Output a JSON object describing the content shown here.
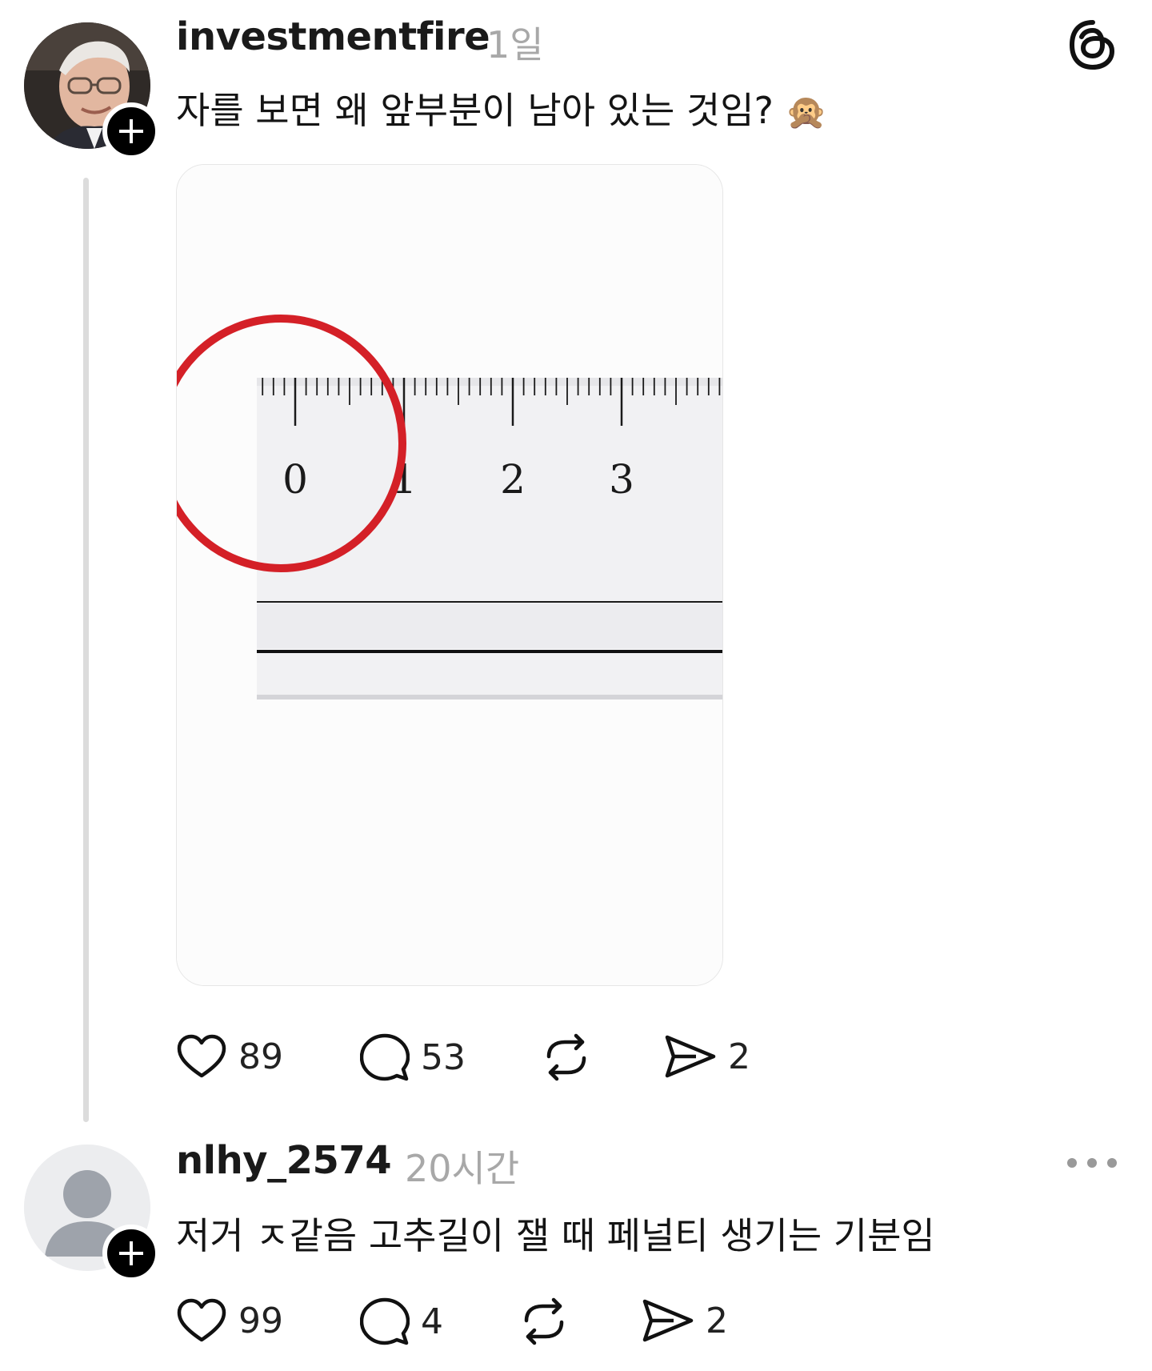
{
  "post": {
    "username": "investmentfire",
    "time": "1일",
    "text": "자를 보면 왜 앞부분이 남아 있는 것임?",
    "emoji": "🙊",
    "image": {
      "ruler_labels": [
        "0",
        "1",
        "2",
        "3"
      ]
    },
    "actions": {
      "likes": "89",
      "replies": "53",
      "reposts": "",
      "shares": "2"
    }
  },
  "reply": {
    "username": "nlhy_2574",
    "time": "20시간",
    "text": "저거 ㅈ같음 고추길이 잴 때 페널티 생기는 기분임",
    "actions": {
      "likes": "99",
      "replies": "4",
      "reposts": "",
      "shares": "2"
    }
  },
  "icons": {
    "logo": "threads-logo-icon",
    "like": "heart-icon",
    "reply": "comment-icon",
    "repost": "repost-icon",
    "share": "send-icon",
    "more": "more-dots-icon",
    "follow": "plus-icon"
  },
  "colors": {
    "accent_circle": "#d42027",
    "muted_text": "#a8a8a8"
  }
}
